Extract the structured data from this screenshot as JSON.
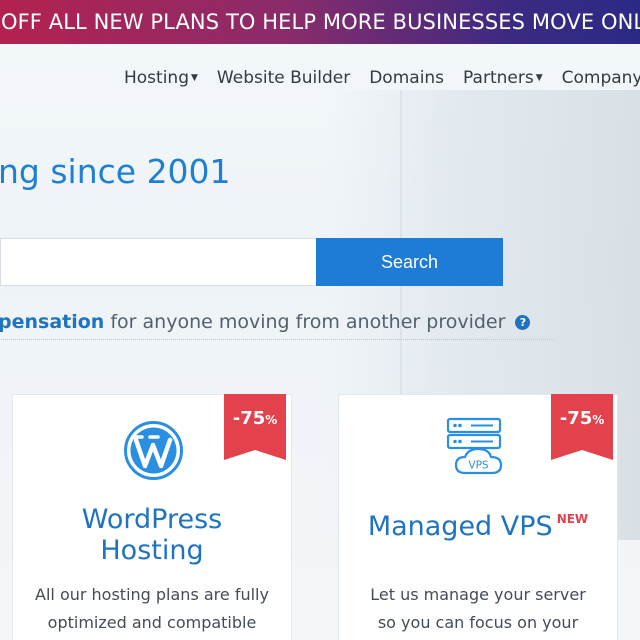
{
  "banner": {
    "text": "OFF ALL NEW PLANS TO HELP MORE BUSINESSES MOVE ONLINE"
  },
  "nav": {
    "items": [
      {
        "label": "Hosting",
        "dropdown": true
      },
      {
        "label": "Website Builder",
        "dropdown": false
      },
      {
        "label": "Domains",
        "dropdown": false
      },
      {
        "label": "Partners",
        "dropdown": true
      },
      {
        "label": "Company",
        "dropdown": true
      }
    ]
  },
  "hero": {
    "title": "ng since 2001"
  },
  "search": {
    "input_value": "",
    "button_label": "Search"
  },
  "compensation": {
    "strong_text": "pensation",
    "rest_text": " for anyone moving from another provider"
  },
  "cards": [
    {
      "discount_number": "-75",
      "discount_unit": "%",
      "title_line1": "WordPress",
      "title_line2": "Hosting",
      "badge": "",
      "desc_line1": "All our hosting plans are fully",
      "desc_line2": "optimized and compatible",
      "icon": "wordpress-icon"
    },
    {
      "discount_number": "-75",
      "discount_unit": "%",
      "title_line1": "Managed VPS",
      "badge": "NEW",
      "icon_text": "VPS",
      "desc_line1": "Let us manage your server",
      "desc_line2": "so you can focus on your",
      "icon": "vps-server-icon"
    }
  ],
  "colors": {
    "accent": "#1f73bf",
    "button": "#1e7bd6",
    "ribbon": "#e3424d"
  }
}
